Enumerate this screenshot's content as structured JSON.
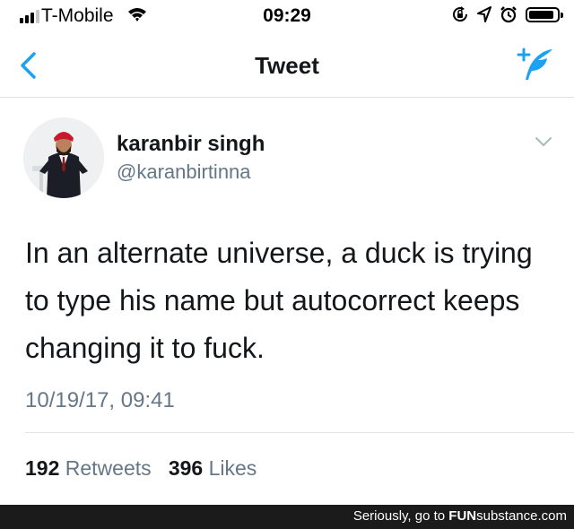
{
  "status_bar": {
    "carrier": "T-Mobile",
    "time": "09:29",
    "battery_level": 0.9,
    "icons": [
      "signal-icon",
      "wifi-icon",
      "orientation-lock-icon",
      "location-icon",
      "alarm-icon",
      "battery-icon"
    ]
  },
  "nav": {
    "title": "Tweet",
    "back_icon": "chevron-left-icon",
    "compose_icon": "compose-tweet-icon"
  },
  "tweet": {
    "display_name": "karanbir singh",
    "handle": "@karanbirtinna",
    "text": "In an alternate universe, a duck is trying to type his name but autocorrect keeps changing it to fuck.",
    "timestamp": "10/19/17, 09:41",
    "retweets_count": "192",
    "retweets_label": "Retweets",
    "likes_count": "396",
    "likes_label": "Likes"
  },
  "watermark": {
    "prefix": "Seriously, go to",
    "site_fun": "FUN",
    "site_rest": "substance.com"
  },
  "colors": {
    "accent": "#1da1f2",
    "text_primary": "#14171a",
    "text_secondary": "#657786",
    "divider": "#dfe3e8"
  }
}
